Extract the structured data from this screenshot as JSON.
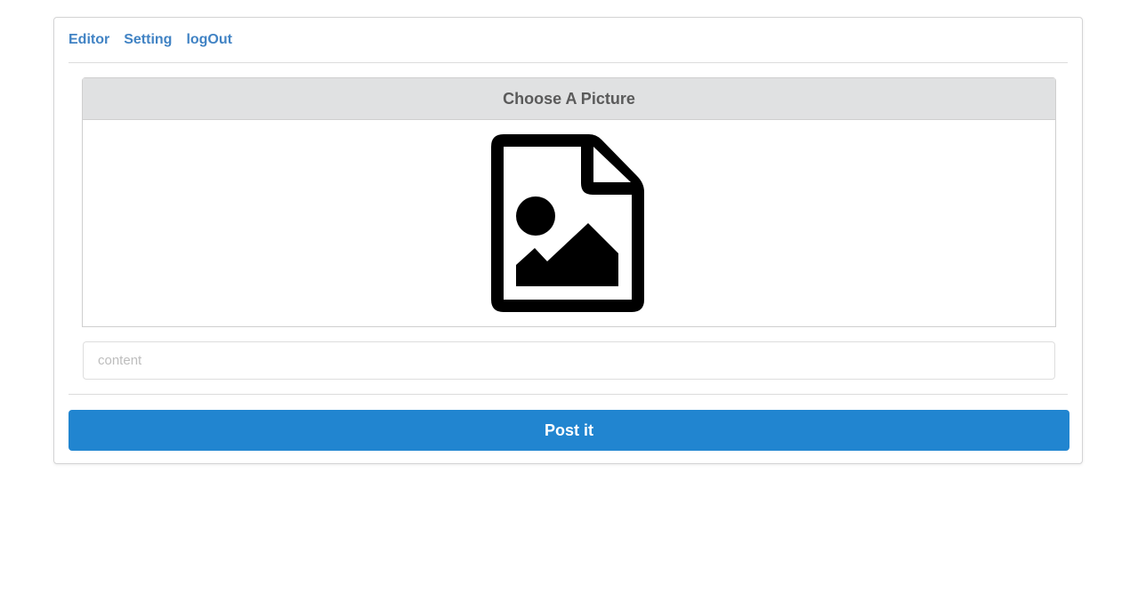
{
  "nav": {
    "items": [
      {
        "label": "Editor"
      },
      {
        "label": "Setting"
      },
      {
        "label": "logOut"
      }
    ],
    "link_color": "#4183c4"
  },
  "picker": {
    "title": "Choose A Picture",
    "icon": "file-image-icon"
  },
  "content_input": {
    "placeholder": "content",
    "value": ""
  },
  "submit": {
    "label": "Post it",
    "color": "#2185d0"
  }
}
